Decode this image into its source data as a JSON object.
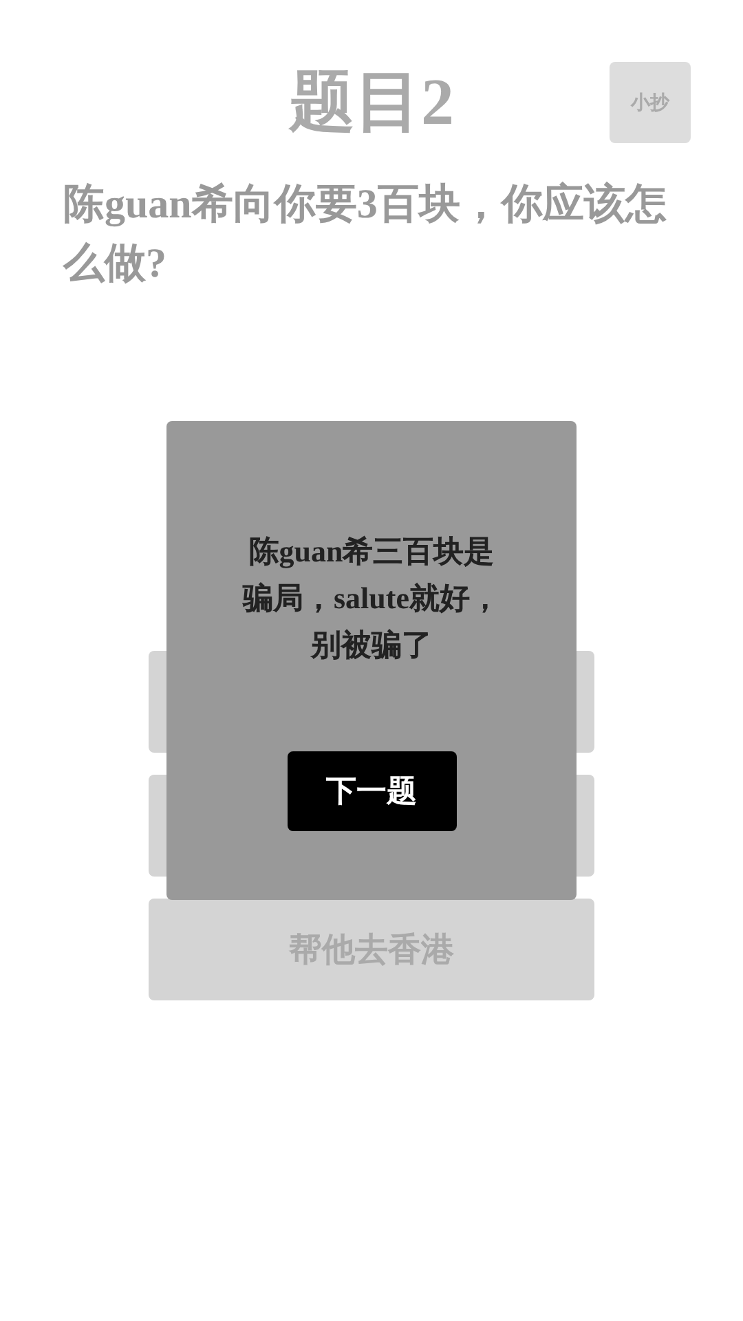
{
  "header": {
    "title": "题目2",
    "cheat_button": "小抄"
  },
  "question": "陈guan希向你要3百块，你应该怎么做?",
  "options": [
    {
      "kind": "covered"
    },
    {
      "kind": "covered"
    },
    {
      "kind": "answer",
      "label": "帮他去香港"
    }
  ],
  "dialog": {
    "message": "陈guan希三百块是骗局，salute就好，别被骗了",
    "button": "下一题"
  }
}
